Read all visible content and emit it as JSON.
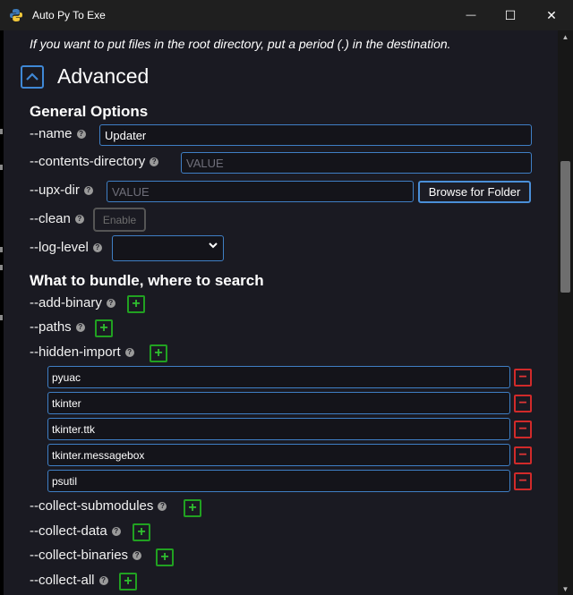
{
  "window": {
    "title": "Auto Py To Exe",
    "controls": {
      "minimize": "—",
      "maximize": "☐",
      "close": "✕"
    }
  },
  "info_note": "If you want to put files in the root directory, put a period (.) in the destination.",
  "advanced": {
    "toggle_icon": "chevron-up-icon",
    "title": "Advanced"
  },
  "general_options": {
    "heading": "General Options",
    "name": {
      "label": "--name",
      "value": "Updater"
    },
    "contents_directory": {
      "label": "--contents-directory",
      "placeholder": "VALUE"
    },
    "upx_dir": {
      "label": "--upx-dir",
      "placeholder": "VALUE",
      "browse_label": "Browse for Folder"
    },
    "clean": {
      "label": "--clean",
      "button_label": "Enable"
    },
    "log_level": {
      "label": "--log-level",
      "value": ""
    }
  },
  "bundle": {
    "heading": "What to bundle, where to search",
    "add_binary_label": "--add-binary",
    "paths_label": "--paths",
    "hidden_import_label": "--hidden-import",
    "hidden_imports": [
      "pyuac",
      "tkinter",
      "tkinter.ttk",
      "tkinter.messagebox",
      "psutil"
    ],
    "collect_submodules_label": "--collect-submodules",
    "collect_data_label": "--collect-data",
    "collect_binaries_label": "--collect-binaries",
    "collect_all_label": "--collect-all"
  },
  "icons": {
    "help": "?",
    "add": "+",
    "remove": "−",
    "chevron_up": "^",
    "caret_down": "⌄"
  },
  "colors": {
    "accent": "#3f88d6",
    "add": "#21a121",
    "remove": "#d12a2a",
    "background": "#1a1a22"
  }
}
